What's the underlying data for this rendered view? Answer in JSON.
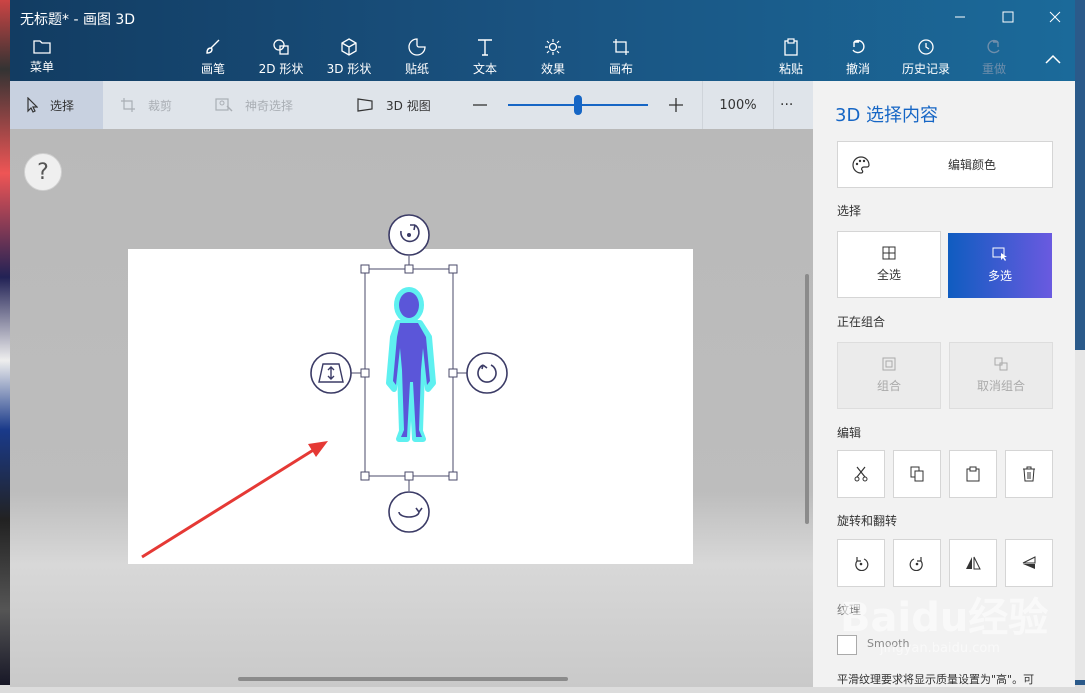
{
  "window": {
    "title": "无标题* - 画图 3D"
  },
  "ribbon": {
    "menu": "菜单",
    "brushes": "画笔",
    "shapes_2d": "2D 形状",
    "shapes_3d": "3D 形状",
    "stickers": "贴纸",
    "text": "文本",
    "effects": "效果",
    "canvas": "画布",
    "paste": "粘贴",
    "undo": "撤消",
    "history": "历史记录",
    "redo": "重做"
  },
  "toolbar": {
    "select": "选择",
    "crop": "裁剪",
    "magic_select": "神奇选择",
    "view_3d": "3D 视图",
    "zoom_label": "100%",
    "zoom_fraction": 0.5,
    "more": "···"
  },
  "help": {
    "label": "?"
  },
  "panel": {
    "title": "3D 选择内容",
    "edit_color": "编辑颜色",
    "select_heading": "选择",
    "select_all": "全选",
    "multi_select": "多选",
    "grouping_heading": "正在组合",
    "group": "组合",
    "ungroup": "取消组合",
    "edit_heading": "编辑",
    "rotate_heading": "旋转和翻转",
    "texture_heading": "纹理",
    "smooth": "Smooth",
    "texture_desc": "平滑纹理要求将显示质量设置为\"高\"。可"
  },
  "watermark": {
    "main": "Baidu经验",
    "sub": "jingyan.baidu.com"
  },
  "colors": {
    "accent": "#1666c5",
    "titlebar": "#1a5381",
    "selection_glow": "#5ff0f0",
    "figure": "#5b56d9",
    "arrow": "#e53935"
  },
  "icons": [
    "folder-icon",
    "brush-icon",
    "shapes-2d-icon",
    "cube-icon",
    "sticker-icon",
    "text-icon",
    "effects-icon",
    "canvas-icon",
    "paste-icon",
    "undo-icon",
    "history-icon",
    "redo-icon",
    "collapse-icon",
    "cursor-icon",
    "crop-icon",
    "magic-select-icon",
    "view-3d-icon",
    "zoom-out-icon",
    "zoom-in-icon",
    "palette-icon",
    "select-all-icon",
    "multi-select-icon",
    "group-icon",
    "ungroup-icon",
    "cut-icon",
    "copy-icon",
    "paste-icon",
    "delete-icon",
    "rotate-left-icon",
    "rotate-right-icon",
    "flip-horizontal-icon",
    "flip-vertical-icon"
  ]
}
